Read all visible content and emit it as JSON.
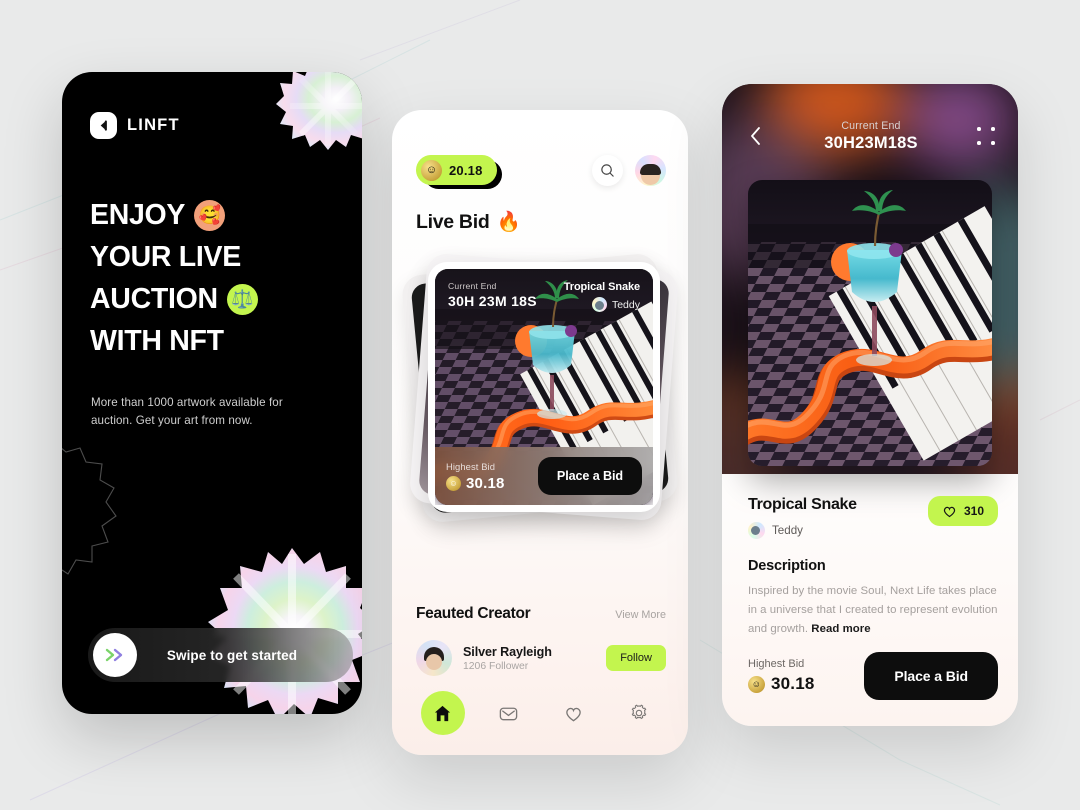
{
  "theme": {
    "background": "#e9eaea",
    "accent_green": "#c3f54e",
    "dark": "#0d0d0d",
    "light_card": "#ffffff"
  },
  "onboarding": {
    "logo_text": "LINFT",
    "logo_icon": "back-arrow-icon",
    "headline_lines": [
      {
        "text": "ENJOY",
        "emoji": "🥰",
        "emoji_name": "smiling-face-with-hearts-emoji",
        "emoji_bg": "orange"
      },
      {
        "text": "YOUR LIVE",
        "emoji": "",
        "emoji_name": "",
        "emoji_bg": ""
      },
      {
        "text": "AUCTION",
        "emoji": "⚖️",
        "emoji_name": "balance-scale-emoji",
        "emoji_bg": "green"
      },
      {
        "text": "WITH NFT",
        "emoji": "",
        "emoji_name": "",
        "emoji_bg": ""
      }
    ],
    "subtitle": "More than 1000 artwork available for auction. Get your art from now.",
    "swipe_label": "Swipe to get started",
    "swipe_icon": "double-chevron-right-icon"
  },
  "home": {
    "balance": "20.18",
    "balance_icon": "coin-icon",
    "search_icon": "search-icon",
    "avatar_name": "user-avatar",
    "section_title": "Live Bid",
    "section_emoji": "🔥",
    "card": {
      "current_end_label": "Current End",
      "timer": "30H 23M 18S",
      "nft_name": "Tropical Snake",
      "author": "Teddy",
      "highest_bid_label": "Highest Bid",
      "highest_bid_value": "30.18",
      "cta": "Place a Bid"
    },
    "featured": {
      "title": "Feauted Creator",
      "view_more": "View More",
      "creator_name": "Silver Rayleigh",
      "creator_followers": "1206 Follower",
      "follow_label": "Follow"
    },
    "nav": [
      {
        "name": "home-icon",
        "label": "Home",
        "active": true
      },
      {
        "name": "mail-icon",
        "label": "Messages",
        "active": false
      },
      {
        "name": "heart-icon",
        "label": "Favorites",
        "active": false
      },
      {
        "name": "gear-icon",
        "label": "Settings",
        "active": false
      }
    ]
  },
  "detail": {
    "back_icon": "chevron-left-icon",
    "menu_icon": "grid-dots-icon",
    "current_end_label": "Current End",
    "timer": "30H23M18S",
    "nft_name": "Tropical Snake",
    "author": "Teddy",
    "likes": "310",
    "like_icon": "heart-icon",
    "description_title": "Description",
    "description": "Inspired by the movie Soul, Next Life takes place in a universe that I created to represent evolution and growth.",
    "read_more": "Read more",
    "highest_bid_label": "Highest Bid",
    "highest_bid_value": "30.18",
    "cta": "Place a Bid"
  }
}
